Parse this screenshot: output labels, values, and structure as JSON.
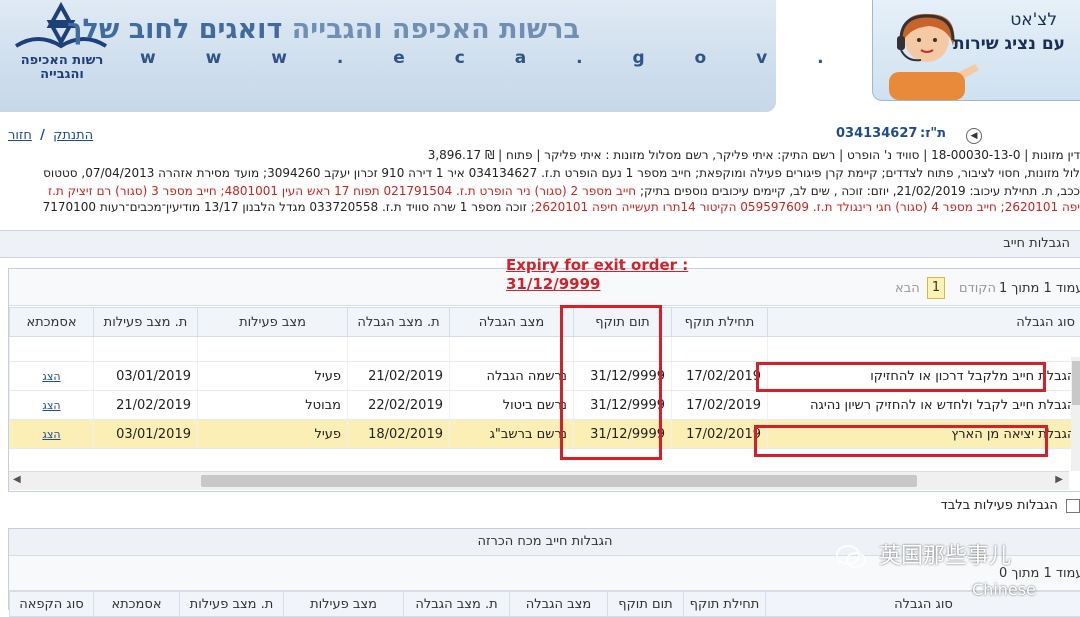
{
  "header": {
    "title_light": "ברשות האכיפה והגבייה",
    "title_bold": "דואגים לחוב שלך",
    "url": "w w w . e c a . g o v . i l",
    "logo_text_1": "רשות האכיפה",
    "logo_text_2": "והגבייה"
  },
  "chat": {
    "line1": "לצ'אט",
    "line2": "עם נציג שירות"
  },
  "nav": {
    "logout": "התנתק",
    "separator": "/",
    "back": "חזור"
  },
  "case": {
    "tz_label": "ת\"ז:",
    "tz_number": "034134627"
  },
  "info_lines": {
    "line1": "דין מזונות | 18-00030-13-0 | סוויד נ' הופרט | רשם התיק: איתי פליקר, רשם מסלול מזונות : איתי פליקר | פתוח | ₪ 3,896.17",
    "line2": "לול מזונות, חסוי לציבור, פתוח לצדדים; קיימת קרן פיגורים פעילה ומוקפאת; חייב מספר 1 נעם הופרט ת.ז. 034134627 איר 1 דירה 910 זכרון יעקב 3094260; מועד מסירת אזהרה 07/04/2013, סטטוס",
    "line3_dark": "ככב, ת. תחילת עיכוב: 21/02/2019, יוזם: זוכה , שים לב, קיימים עיכובים נוספים בתיק;",
    "line3_red": "חייב מספר 2 (סגור) ניר הופרט ת.ז. 021791504 תפוח 17 ראש העין 4801001; חייב מספר 3 (סגור) רם זיציק ת.ז",
    "line4_red": "יפה 2620101; חייב מספר 4 (סגור) חגי רינגולד ת.ז. 059597609 הקיטור 14תרו תעשייה חיפה 2620101;",
    "line4_dark": "זוכה מספר 1 שרה סוויד ת.ז. 033720558 מגדל הלבנון 13/17 מודיעין־מכבים־רעות 7170100"
  },
  "section": {
    "title": "הגבלות חייב"
  },
  "pager": {
    "page_of": "עמוד 1 מתוך 1",
    "current": "1",
    "prev": "הקודם",
    "next": "הבא"
  },
  "table": {
    "headers": [
      "סוג הגבלה",
      "תחילת תוקף",
      "תום תוקף",
      "מצב הגבלה",
      "ת. מצב הגבלה",
      "מצב פעילות",
      "ת. מצב פעילות",
      "אסמכתא"
    ],
    "rows": [
      {
        "type": "הגבלת חייב מלקבל דרכון או להחזיקו",
        "start": "17/02/2019",
        "end": "31/12/9999",
        "status": "נרשמה הגבלה",
        "status_date": "21/02/2019",
        "activity": "פעיל",
        "activity_date": "03/01/2019",
        "ref": "הצג"
      },
      {
        "type": "הגבלת חייב לקבל ולחדש או להחזיק רשיון נהיגה",
        "start": "17/02/2019",
        "end": "31/12/9999",
        "status": "נרשם ביטול",
        "status_date": "22/02/2019",
        "activity": "מבוטל",
        "activity_date": "21/02/2019",
        "ref": "הצג"
      },
      {
        "type": "הגבלת יציאה מן הארץ",
        "start": "17/02/2019",
        "end": "31/12/9999",
        "status": "נרשם ברשב\"ג",
        "status_date": "18/02/2019",
        "activity": "פעיל",
        "activity_date": "03/01/2019",
        "ref": "הצג"
      }
    ]
  },
  "filter": {
    "active_only": "הגבלות פעילות בלבד"
  },
  "section2": {
    "title": "הגבלות חייב מכח הכרזה",
    "page_of": "עמוד 1 מתוך 0",
    "headers": [
      "סוג הגבלה",
      "תחילת תוקף",
      "תום תוקף",
      "מצב הגבלה",
      "ת. מצב הגבלה",
      "מצב פעילות",
      "ת. מצב פעילות",
      "אסמכתא",
      "סוג הקפאה"
    ]
  },
  "annotation": {
    "line1": "Expiry for exit order :",
    "line2": "31/12/9999"
  },
  "watermark": {
    "text": "英国那些事儿",
    "sub": "Chinese"
  },
  "colors": {
    "highlight_red": "#d3202a",
    "selected_row": "#fbefb6",
    "link_blue": "#1f4c8c"
  }
}
